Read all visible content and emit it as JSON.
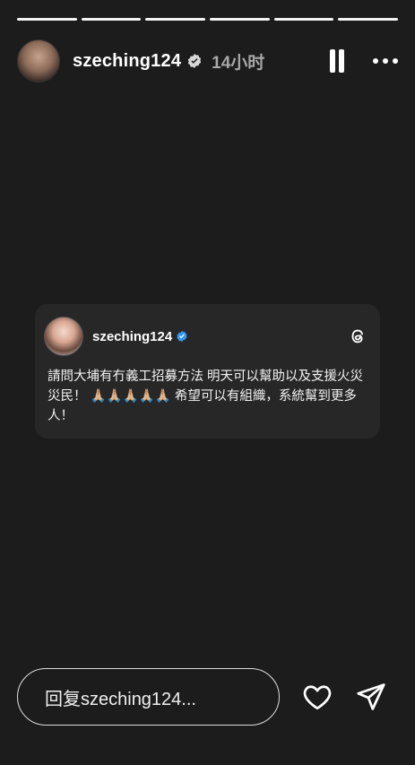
{
  "progress_segments": 6,
  "header": {
    "username": "szeching124",
    "time": "14小时",
    "verified": true
  },
  "card": {
    "username": "szeching124",
    "text": "請問大埔有冇義工招募方法 明天可以幫助以及支援火災災民！ 🙏🏼🙏🏼🙏🏼🙏🏼🙏🏼 希望可以有組織，系統幫到更多人！"
  },
  "reply": {
    "placeholder": "回复szeching124..."
  },
  "colors": {
    "background": "#1c1c1c",
    "card": "#272727",
    "verified": "#3797f0"
  },
  "icons": [
    "pause-icon",
    "more-icon",
    "threads-icon",
    "heart-icon",
    "send-icon",
    "verified-icon"
  ]
}
